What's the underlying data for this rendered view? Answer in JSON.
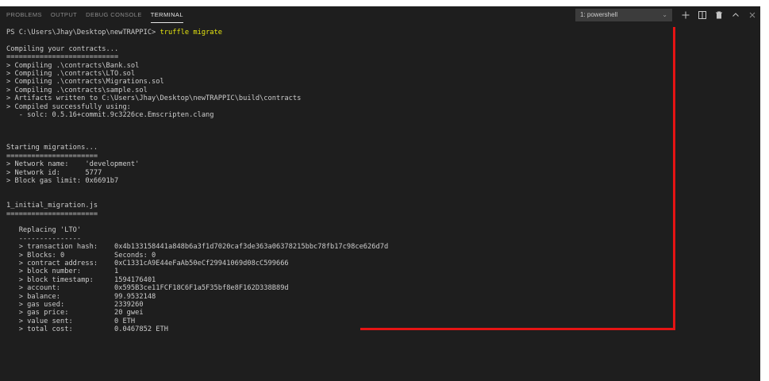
{
  "tabs": [
    {
      "label": "PROBLEMS"
    },
    {
      "label": "OUTPUT"
    },
    {
      "label": "DEBUG CONSOLE"
    },
    {
      "label": "TERMINAL"
    }
  ],
  "terminal_select": {
    "value": "1: powershell"
  },
  "icons": {
    "chevron": "chevron-down-icon",
    "add": "plus-icon",
    "split": "split-terminal-icon",
    "trash": "trash-icon",
    "maximize": "chevron-up-icon",
    "close": "close-icon"
  },
  "colors": {
    "background": "#1e1e1e",
    "text": "#cccccc",
    "command": "#e5e510",
    "annotation": "#e51414"
  },
  "terminal": {
    "prompt": "PS C:\\Users\\Jhay\\Desktop\\newTRAPPIC> ",
    "command": "truffle migrate",
    "lines": [
      "",
      "Compiling your contracts...",
      "===========================",
      "> Compiling .\\contracts\\Bank.sol",
      "> Compiling .\\contracts\\LTO.sol",
      "> Compiling .\\contracts\\Migrations.sol",
      "> Compiling .\\contracts\\sample.sol",
      "> Artifacts written to C:\\Users\\Jhay\\Desktop\\newTRAPPIC\\build\\contracts",
      "> Compiled successfully using:",
      "   - solc: 0.5.16+commit.9c3226ce.Emscripten.clang",
      "",
      "",
      "",
      "Starting migrations...",
      "======================",
      "> Network name:    'development'",
      "> Network id:      5777",
      "> Block gas limit: 0x6691b7",
      "",
      "",
      "1_initial_migration.js",
      "======================",
      "",
      "   Replacing 'LTO'",
      "   ---------------",
      "   > transaction hash:    0x4b133158441a848b6a3f1d7020caf3de363a06378215bbc78fb17c98ce626d7d",
      "   > Blocks: 0            Seconds: 0",
      "   > contract address:    0xC1331cA9E44eFaAb50eCf29941069d08cC599666",
      "   > block number:        1",
      "   > block timestamp:     1594176401",
      "   > account:             0x595B3ce11FCF18C6F1a5F35bf8e8F162D338B89d",
      "   > balance:             99.9532148",
      "   > gas used:            2339260",
      "   > gas price:           20 gwei",
      "   > value sent:          0 ETH",
      "   > total cost:          0.0467852 ETH"
    ]
  }
}
